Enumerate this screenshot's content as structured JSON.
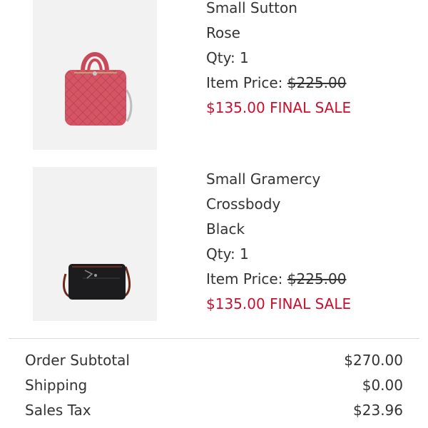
{
  "cart": {
    "items": [
      {
        "name": "Small Sutton",
        "color": "Rose",
        "qty": "Qty: 1",
        "price_label": "Item Price:",
        "original_price": "$225.00",
        "sale_price": "$135.00 FINAL SALE",
        "thumb_colors": {
          "bag": "#d65564",
          "trim": "#e07a85",
          "hardware": "#c8c8c8"
        }
      },
      {
        "name_line1": "Small Gramercy",
        "name_line2": "Crossbody",
        "color": "Black",
        "qty": "Qty: 1",
        "price_label": "Item Price:",
        "original_price": "$225.00",
        "sale_price": "$135.00 FINAL SALE",
        "thumb_colors": {
          "bag": "#1c1c1e",
          "strap": "#6b2a1a"
        }
      }
    ]
  },
  "summary": {
    "subtotal_label": "Order Subtotal",
    "subtotal_value": "$270.00",
    "shipping_label": "Shipping",
    "shipping_value": "$0.00",
    "tax_label": "Sales Tax",
    "tax_value": "$23.96"
  },
  "colors": {
    "sale": "#c8102e",
    "text": "#333333",
    "divider": "#dcdcdc",
    "thumb_bg": "#f2f2f2"
  }
}
